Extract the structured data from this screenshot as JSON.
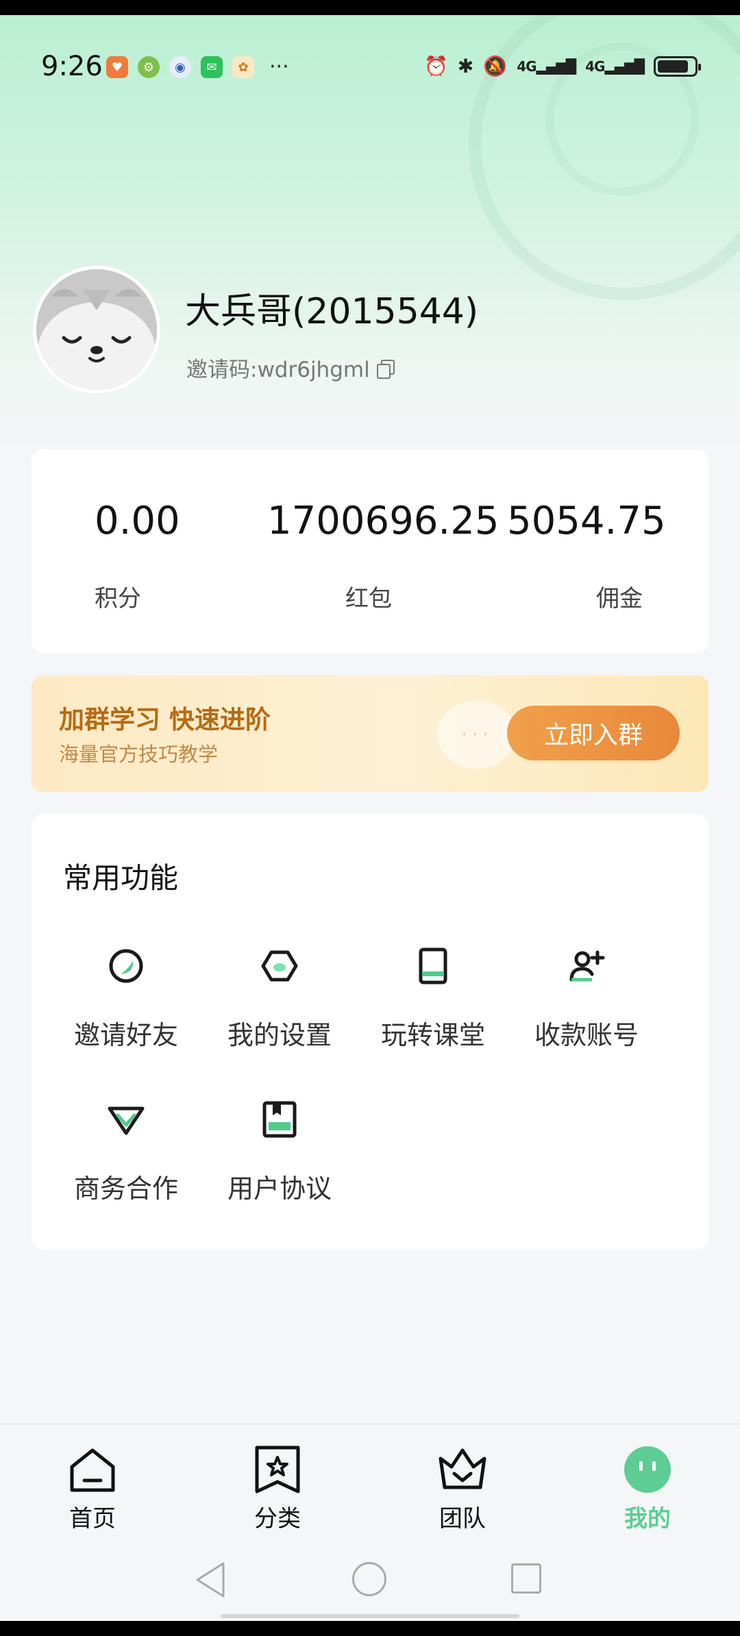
{
  "status_bar": {
    "time": "9:26",
    "overflow": "···",
    "network": [
      "4G",
      "4G"
    ],
    "app_icons": [
      "health-app-icon",
      "settings-app-icon",
      "browser-app-icon",
      "wechat-icon",
      "store-app-icon"
    ]
  },
  "profile": {
    "nickname": "大兵哥(2015544)",
    "invite_code": "邀请码:wdr6jhgml"
  },
  "stats": [
    {
      "value": "0.00",
      "label": "积分"
    },
    {
      "value": "1700696.25",
      "label": "红包"
    },
    {
      "value": "5054.75",
      "label": "佣金"
    }
  ],
  "banner": {
    "title": "加群学习 快速进阶",
    "subtitle": "海量官方技巧教学",
    "bubble": "···",
    "button": "立即入群"
  },
  "functions": {
    "title": "常用功能",
    "items": [
      {
        "label": "邀请好友",
        "icon": "invite-icon"
      },
      {
        "label": "我的设置",
        "icon": "settings-hexagon-icon"
      },
      {
        "label": "玩转课堂",
        "icon": "book-icon"
      },
      {
        "label": "收款账号",
        "icon": "add-user-icon"
      },
      {
        "label": "商务合作",
        "icon": "diamond-icon"
      },
      {
        "label": "用户协议",
        "icon": "document-icon"
      }
    ]
  },
  "nav": {
    "items": [
      {
        "label": "首页",
        "icon": "home-icon"
      },
      {
        "label": "分类",
        "icon": "bookmark-star-icon"
      },
      {
        "label": "团队",
        "icon": "crown-icon"
      },
      {
        "label": "我的",
        "icon": "profile-face-icon"
      }
    ],
    "active_index": 3,
    "active_color": "#5dcd94"
  },
  "colors": {
    "accent_green": "#5dcd94",
    "banner_orange": "#e9883a",
    "banner_text": "#b66a12"
  }
}
